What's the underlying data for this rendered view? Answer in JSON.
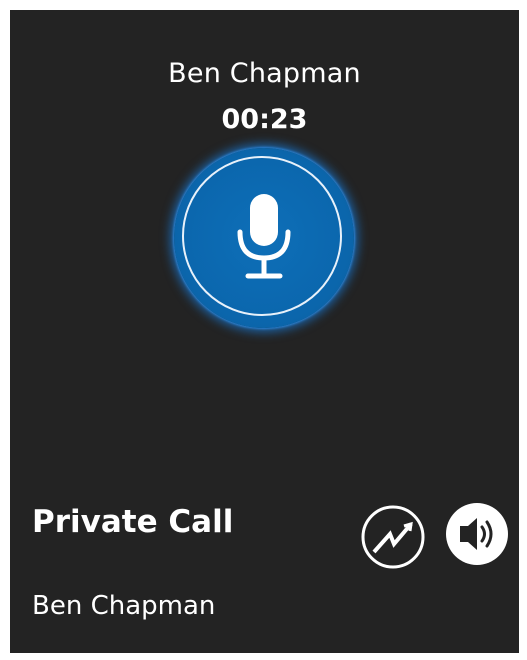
{
  "call": {
    "caller_name": "Ben Chapman",
    "timer": "00:23",
    "type": "Private Call",
    "party_name": "Ben Chapman"
  },
  "controls": {
    "ptt_icon": "microphone-icon",
    "emergency_icon": "emergency-pulse-icon",
    "speaker_icon": "speaker-icon"
  },
  "colors": {
    "background": "#232323",
    "ptt_blue": "#0b67ae",
    "ptt_glow": "#1978d2",
    "text": "#ffffff"
  }
}
